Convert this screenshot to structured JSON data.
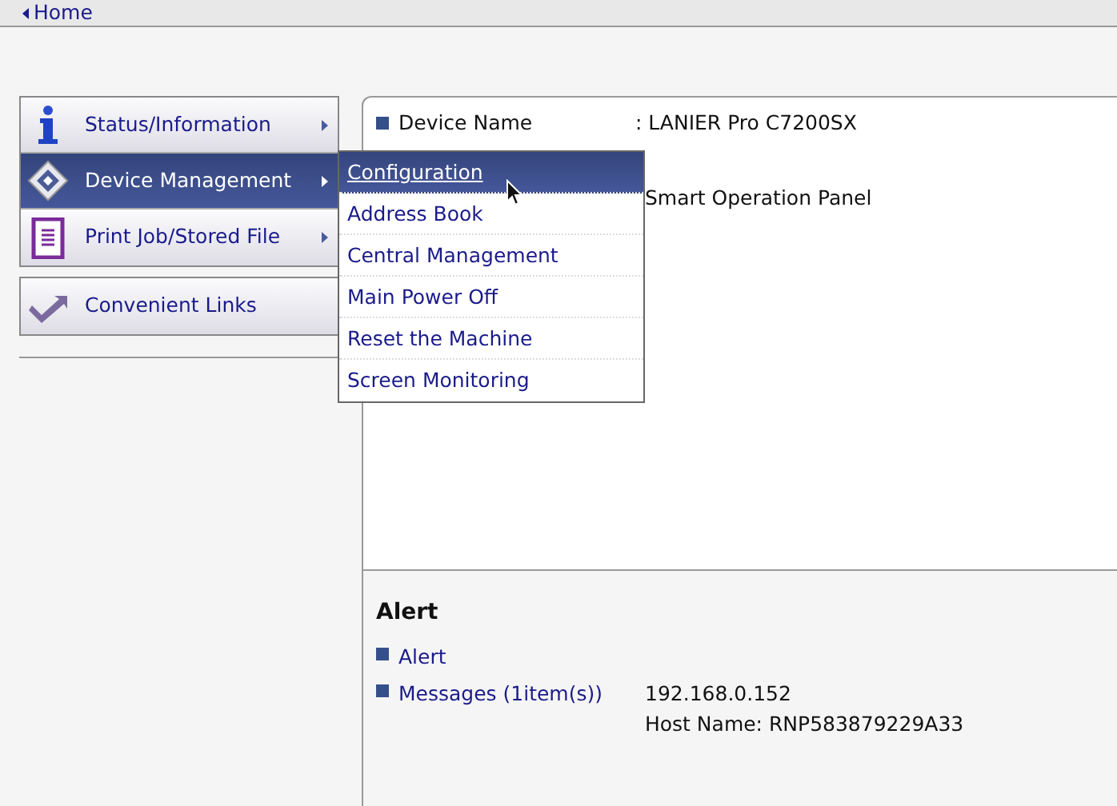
{
  "breadcrumb": {
    "label": "Home"
  },
  "nav_menu": [
    {
      "label": "Status/Information",
      "kind": "info",
      "selected": false
    },
    {
      "label": "Device Management",
      "kind": "diamond",
      "selected": true
    },
    {
      "label": "Print Job/Stored File",
      "kind": "document",
      "selected": false
    }
  ],
  "links_menu": [
    {
      "label": "Convenient Links",
      "kind": "arrow"
    }
  ],
  "submenu": [
    {
      "label": "Configuration",
      "selected": true
    },
    {
      "label": "Address Book",
      "selected": false
    },
    {
      "label": "Central Management",
      "selected": false
    },
    {
      "label": "Main Power Off",
      "selected": false
    },
    {
      "label": "Reset the Machine",
      "selected": false
    },
    {
      "label": "Screen Monitoring",
      "selected": false
    }
  ],
  "device_info": [
    {
      "label": "Device Name",
      "value": ": LANIER Pro C7200SX"
    },
    {
      "value": "Smart Operation Panel"
    }
  ],
  "alert": {
    "title": "Alert",
    "items": [
      {
        "label": "Alert"
      },
      {
        "label": "Messages (1item(s))",
        "details": [
          "192.168.0.152",
          "Host Name: RNP583879229A33"
        ]
      }
    ]
  }
}
